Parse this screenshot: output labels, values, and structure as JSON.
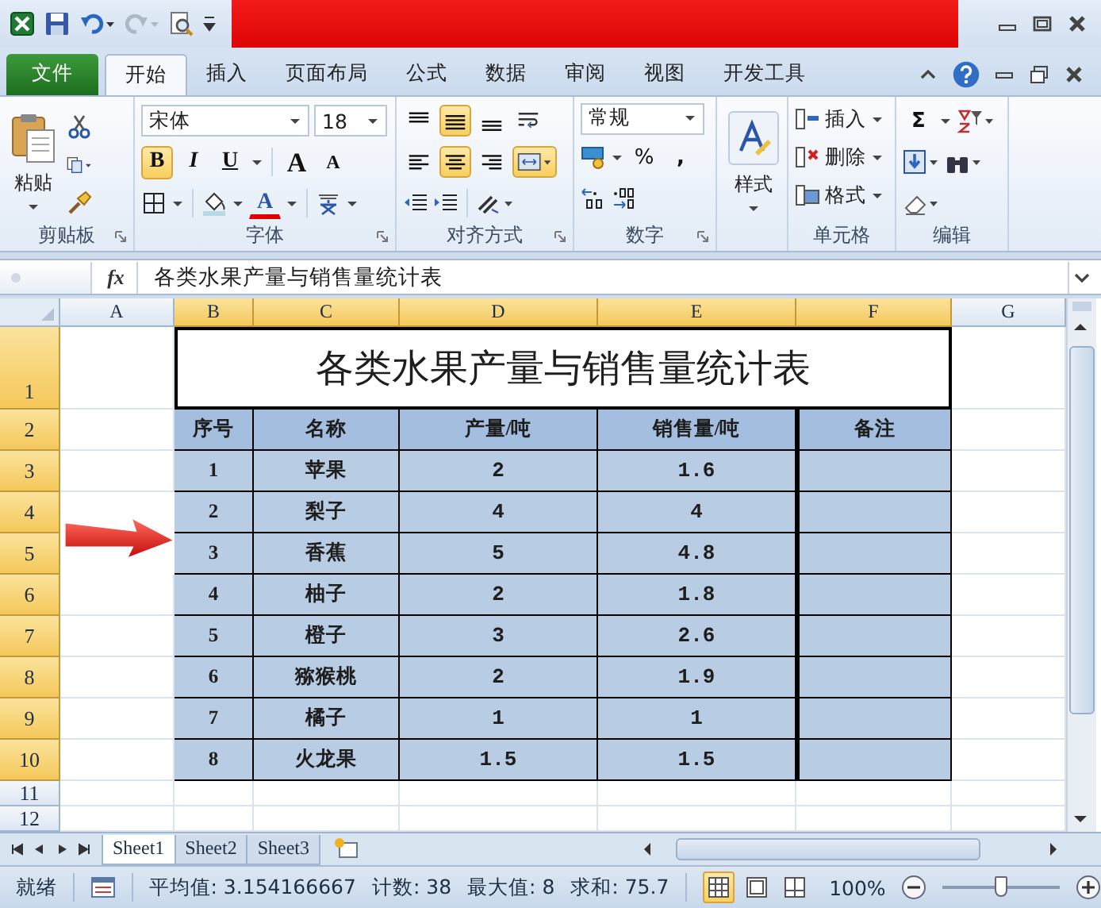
{
  "quick_access": [
    {
      "kind": "save",
      "disabled": false
    },
    {
      "kind": "undo",
      "disabled": false
    },
    {
      "kind": "redo",
      "disabled": true
    },
    {
      "kind": "print_preview",
      "disabled": false
    }
  ],
  "menu_tabs": [
    {
      "label": "文件",
      "kind": "file",
      "selected": false
    },
    {
      "label": "开始",
      "kind": "tab",
      "selected": true
    },
    {
      "label": "插入",
      "kind": "tab",
      "selected": false
    },
    {
      "label": "页面布局",
      "kind": "tab",
      "selected": false
    },
    {
      "label": "公式",
      "kind": "tab",
      "selected": false
    },
    {
      "label": "数据",
      "kind": "tab",
      "selected": false
    },
    {
      "label": "审阅",
      "kind": "tab",
      "selected": false
    },
    {
      "label": "视图",
      "kind": "tab",
      "selected": false
    },
    {
      "label": "开发工具",
      "kind": "tab",
      "selected": false
    }
  ],
  "ribbon": {
    "clipboard": {
      "paste": "粘贴",
      "label": "剪贴板"
    },
    "font": {
      "name": "宋体",
      "size": "18",
      "label": "字体",
      "buttons": [
        {
          "kind": "bold",
          "text": "B",
          "on": true
        },
        {
          "kind": "italic",
          "text": "I",
          "on": false
        },
        {
          "kind": "underline",
          "text": "U",
          "on": false
        },
        {
          "kind": "grow",
          "text": "A",
          "on": false
        },
        {
          "kind": "shrink",
          "text": "A",
          "on": false
        }
      ],
      "font_color": "A"
    },
    "alignment": {
      "label": "对齐方式",
      "vertical": [
        {
          "kind": "top",
          "on": false
        },
        {
          "kind": "middle",
          "on": true
        },
        {
          "kind": "bottom",
          "on": false
        }
      ],
      "horizontal": [
        {
          "kind": "left",
          "on": false
        },
        {
          "kind": "center",
          "on": true
        },
        {
          "kind": "right",
          "on": false
        }
      ],
      "wrap_text": false,
      "merge_center": true
    },
    "number": {
      "format": "常规",
      "percent": "%",
      "comma": ",",
      "label": "数字"
    },
    "styles": {
      "label": "样式"
    },
    "cells": {
      "buttons": [
        "插入",
        "删除",
        "格式"
      ],
      "label": "单元格"
    },
    "editing": {
      "sum": "Σ",
      "label": "编辑"
    }
  },
  "formula_bar": {
    "fx": "fx",
    "content": "各类水果产量与销售量统计表"
  },
  "sheet": {
    "columns": [
      {
        "label": "A",
        "selected": false
      },
      {
        "label": "B",
        "selected": true
      },
      {
        "label": "C",
        "selected": true
      },
      {
        "label": "D",
        "selected": true
      },
      {
        "label": "E",
        "selected": true
      },
      {
        "label": "F",
        "selected": true
      },
      {
        "label": "G",
        "selected": false
      }
    ],
    "rows": [
      {
        "label": "1",
        "selected": true
      },
      {
        "label": "2",
        "selected": true
      },
      {
        "label": "3",
        "selected": true
      },
      {
        "label": "4",
        "selected": true
      },
      {
        "label": "5",
        "selected": true
      },
      {
        "label": "6",
        "selected": true
      },
      {
        "label": "7",
        "selected": true
      },
      {
        "label": "8",
        "selected": true
      },
      {
        "label": "9",
        "selected": true
      },
      {
        "label": "10",
        "selected": true
      },
      {
        "label": "11",
        "selected": false
      },
      {
        "label": "12",
        "selected": false
      }
    ],
    "title": "各类水果产量与销售量统计表",
    "table": {
      "headers": [
        "序号",
        "名称",
        "产量/吨",
        "销售量/吨",
        "备注"
      ],
      "rows": [
        [
          "1",
          "苹果",
          "2",
          "1.6"
        ],
        [
          "2",
          "梨子",
          "4",
          "4"
        ],
        [
          "3",
          "香蕉",
          "5",
          "4.8"
        ],
        [
          "4",
          "柚子",
          "2",
          "1.8"
        ],
        [
          "5",
          "橙子",
          "3",
          "2.6"
        ],
        [
          "6",
          "猕猴桃",
          "2",
          "1.9"
        ],
        [
          "7",
          "橘子",
          "1",
          "1"
        ],
        [
          "8",
          "火龙果",
          "1.5",
          "1.5"
        ]
      ]
    }
  },
  "sheet_tabs": [
    {
      "label": "Sheet1",
      "selected": true
    },
    {
      "label": "Sheet2",
      "selected": false
    },
    {
      "label": "Sheet3",
      "selected": false
    }
  ],
  "status_bar": {
    "ready": "就绪",
    "average": "平均值: 3.154166667",
    "count": "计数: 38",
    "max": "最大值: 8",
    "sum": "求和: 75.7",
    "views": [
      {
        "kind": "normal",
        "selected": true
      },
      {
        "kind": "page_layout",
        "selected": false
      },
      {
        "kind": "page_break",
        "selected": false
      }
    ],
    "zoom": "100%",
    "zoom_slider": {
      "level": 0.5
    }
  }
}
